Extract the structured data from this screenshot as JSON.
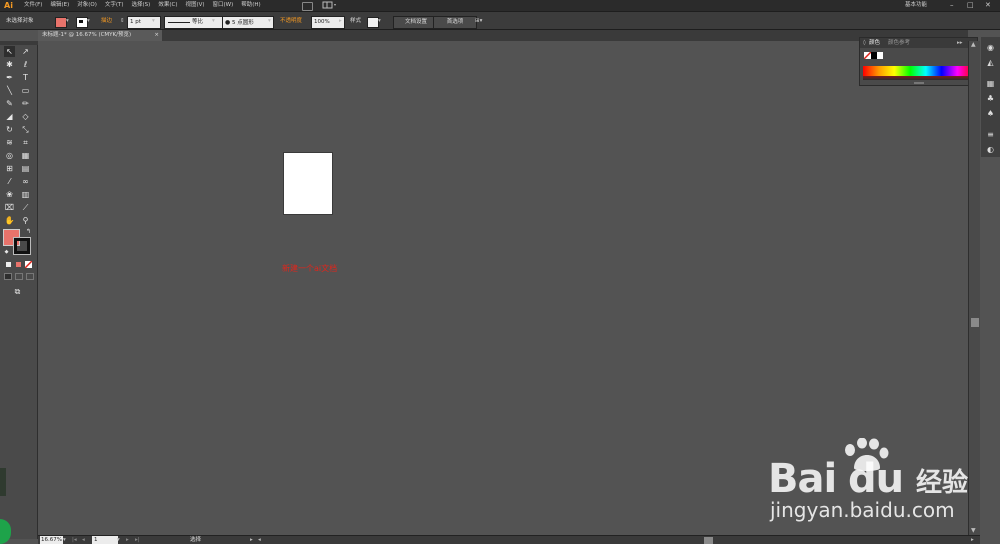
{
  "menubar": {
    "logo": "Ai",
    "items": [
      "文件(F)",
      "编辑(E)",
      "对象(O)",
      "文字(T)",
      "选择(S)",
      "效果(C)",
      "视图(V)",
      "窗口(W)",
      "帮助(H)"
    ],
    "workspace": "基本功能",
    "minimize": "–",
    "maximize": "□",
    "close": "✕"
  },
  "controlbar": {
    "selection_status": "未选择对象",
    "stroke_label": "描边",
    "stroke_weight": "1 pt",
    "stroke_profile": "等比",
    "brush_size": "5 点圆形",
    "opacity_label": "不透明度",
    "opacity_value": "100%",
    "style_label": "样式",
    "doc_setup_button": "文档设置",
    "preferences_button": "首选项"
  },
  "document_tab": {
    "title": "未标题-1* @ 16.67% (CMYK/预览)",
    "close": "×"
  },
  "color_panel": {
    "tab_color": "颜色",
    "tab_guide": "颜色参考",
    "collapse": "▸▸",
    "menu": "≡"
  },
  "canvas": {
    "annotation": "新建一个ai文档"
  },
  "statusbar": {
    "zoom": "16.67%",
    "page": "1",
    "status": "选择"
  },
  "watermark": {
    "brand_bai": "Bai",
    "brand_du": "du",
    "jingyan": "经验",
    "url": "jingyan.baidu.com"
  },
  "colors": {
    "fill_swatch": "#e8736b",
    "accent_orange": "#f59a23",
    "annotation_red": "#e0251b",
    "workspace_gray": "#535353"
  }
}
